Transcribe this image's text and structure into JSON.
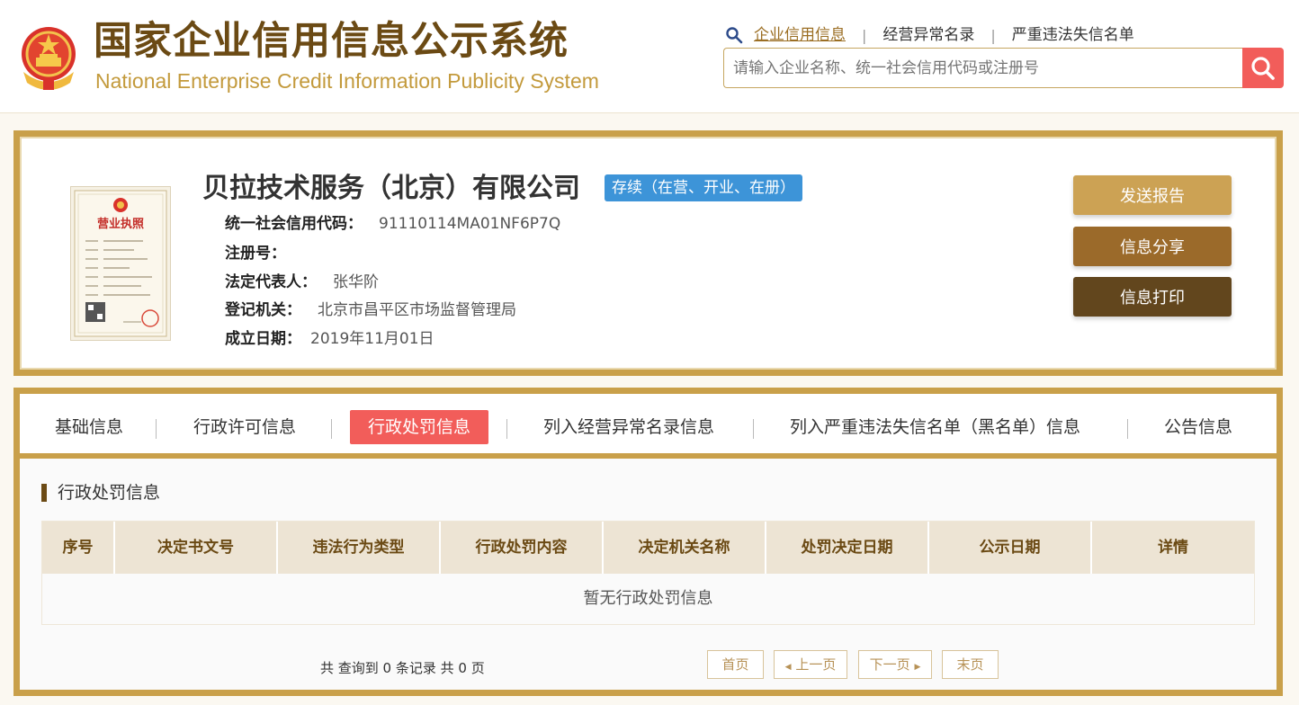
{
  "header": {
    "title_cn": "国家企业信用信息公示系统",
    "title_en": "National Enterprise Credit Information Publicity System",
    "nav": [
      {
        "label": "企业信用信息",
        "active": true
      },
      {
        "label": "经营异常名录",
        "active": false
      },
      {
        "label": "严重违法失信名单",
        "active": false
      }
    ],
    "nav_separator": "|",
    "search_placeholder": "请输入企业名称、统一社会信用代码或注册号",
    "search_icon": "search-icon",
    "emblem_icon": "national-emblem-icon"
  },
  "company": {
    "name": "贝拉技术服务（北京）有限公司",
    "status": "存续（在营、开业、在册）",
    "license_icon": "business-license-icon",
    "license_title": "营业执照",
    "fields": [
      {
        "label": "统一社会信用代码：",
        "value": "91110114MA01NF6P7Q"
      },
      {
        "label": "注册号：",
        "value": ""
      },
      {
        "label": "法定代表人：",
        "value": "张华阶"
      },
      {
        "label": "登记机关：",
        "value": "北京市昌平区市场监督管理局"
      },
      {
        "label": "成立日期：",
        "value": "2019年11月01日"
      }
    ],
    "actions": {
      "send_report": "发送报告",
      "share": "信息分享",
      "print": "信息打印"
    }
  },
  "tabs": [
    {
      "label": "基础信息",
      "active": false
    },
    {
      "label": "行政许可信息",
      "active": false
    },
    {
      "label": "行政处罚信息",
      "active": true
    },
    {
      "label": "列入经营异常名录信息",
      "active": false
    },
    {
      "label": "列入严重违法失信名单（黑名单）信息",
      "active": false
    },
    {
      "label": "公告信息",
      "active": false
    }
  ],
  "tab_separator": "|",
  "section": {
    "title": "行政处罚信息",
    "columns": [
      "序号",
      "决定书文号",
      "违法行为类型",
      "行政处罚内容",
      "决定机关名称",
      "处罚决定日期",
      "公示日期",
      "详情"
    ],
    "empty_text": "暂无行政处罚信息"
  },
  "pagination": {
    "summary": "共 查询到 0 条记录 共 0 页",
    "first": "首页",
    "prev": "上一页",
    "next": "下一页",
    "last": "末页"
  },
  "colors": {
    "brand_gold": "#c9a04a",
    "brand_brown": "#6b4a14",
    "accent_red": "#f25d5a",
    "status_blue": "#3d94d8"
  }
}
